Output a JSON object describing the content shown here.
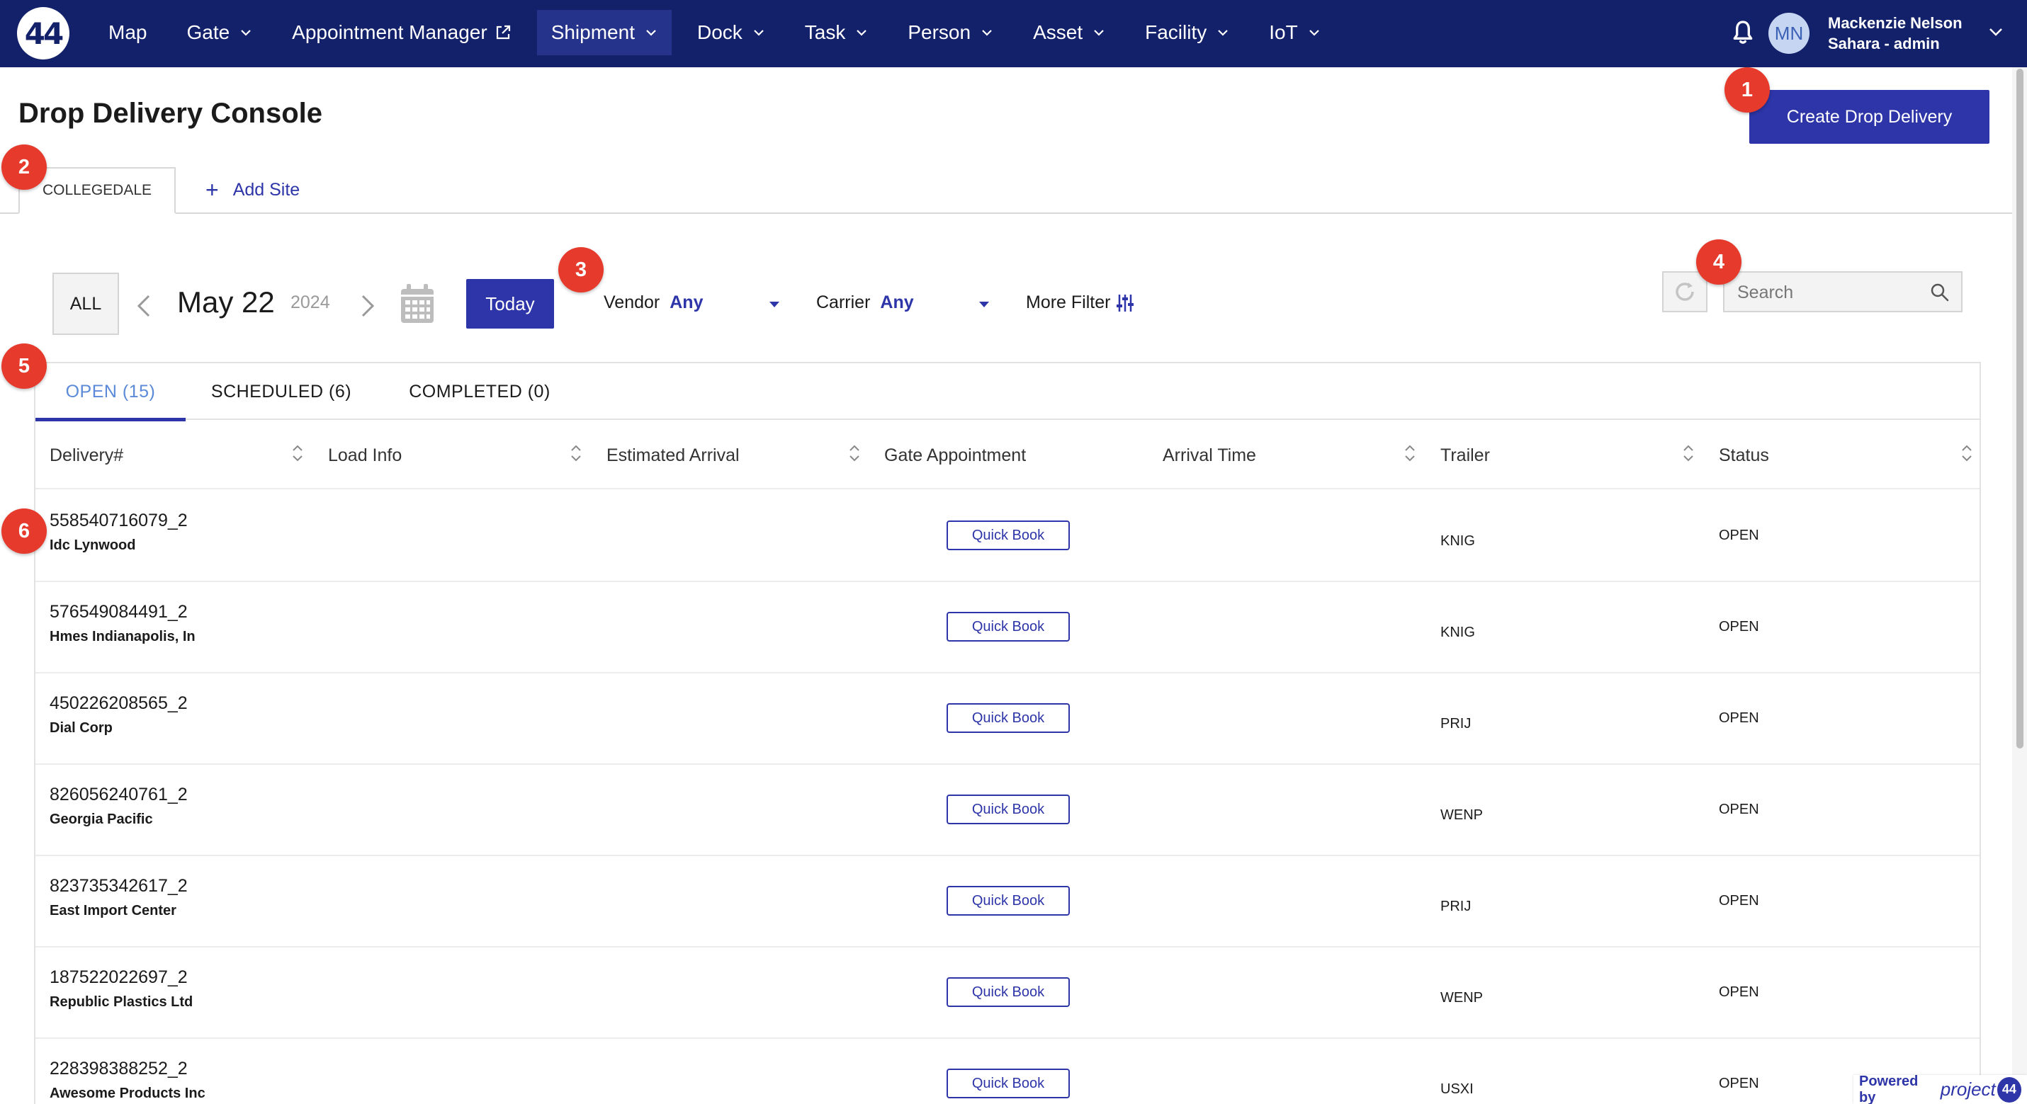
{
  "nav": {
    "logo_text": "44",
    "items": [
      {
        "label": "Map",
        "dropdown": false,
        "external": false,
        "active": false
      },
      {
        "label": "Gate",
        "dropdown": true,
        "external": false,
        "active": false
      },
      {
        "label": "Appointment Manager",
        "dropdown": false,
        "external": true,
        "active": false
      },
      {
        "label": "Shipment",
        "dropdown": true,
        "external": false,
        "active": true
      },
      {
        "label": "Dock",
        "dropdown": true,
        "external": false,
        "active": false
      },
      {
        "label": "Task",
        "dropdown": true,
        "external": false,
        "active": false
      },
      {
        "label": "Person",
        "dropdown": true,
        "external": false,
        "active": false
      },
      {
        "label": "Asset",
        "dropdown": true,
        "external": false,
        "active": false
      },
      {
        "label": "Facility",
        "dropdown": true,
        "external": false,
        "active": false
      },
      {
        "label": "IoT",
        "dropdown": true,
        "external": false,
        "active": false
      }
    ],
    "user": {
      "initials": "MN",
      "name": "Mackenzie Nelson",
      "org": "Sahara - admin"
    }
  },
  "page": {
    "title": "Drop Delivery Console",
    "create_label": "Create Drop Delivery"
  },
  "sites": {
    "active": "COLLEGEDALE",
    "add_label": "Add Site"
  },
  "filters": {
    "all_label": "ALL",
    "date": "May 22",
    "year": "2024",
    "today_label": "Today",
    "vendor_label": "Vendor",
    "vendor_value": "Any",
    "carrier_label": "Carrier",
    "carrier_value": "Any",
    "more_label": "More Filter",
    "search_placeholder": "Search"
  },
  "status_tabs": [
    {
      "label": "OPEN (15)",
      "active": true
    },
    {
      "label": "SCHEDULED (6)",
      "active": false
    },
    {
      "label": "COMPLETED (0)",
      "active": false
    }
  ],
  "table": {
    "columns": [
      "Delivery#",
      "Load Info",
      "Estimated Arrival",
      "Gate Appointment",
      "Arrival Time",
      "Trailer",
      "Status"
    ],
    "quick_book_label": "Quick Book",
    "rows": [
      {
        "id": "558540716079_2",
        "vendor": "Idc Lynwood",
        "trailer": "KNIG",
        "status": "OPEN"
      },
      {
        "id": "576549084491_2",
        "vendor": "Hmes Indianapolis, In",
        "trailer": "KNIG",
        "status": "OPEN"
      },
      {
        "id": "450226208565_2",
        "vendor": "Dial Corp",
        "trailer": "PRIJ",
        "status": "OPEN"
      },
      {
        "id": "826056240761_2",
        "vendor": "Georgia Pacific",
        "trailer": "WENP",
        "status": "OPEN"
      },
      {
        "id": "823735342617_2",
        "vendor": "East Import Center",
        "trailer": "PRIJ",
        "status": "OPEN"
      },
      {
        "id": "187522022697_2",
        "vendor": "Republic Plastics Ltd",
        "trailer": "WENP",
        "status": "OPEN"
      },
      {
        "id": "228398388252_2",
        "vendor": "Awesome Products Inc",
        "trailer": "USXI",
        "status": "OPEN"
      }
    ]
  },
  "badges": [
    "1",
    "2",
    "3",
    "4",
    "5",
    "6"
  ],
  "powered": {
    "prefix": "Powered by",
    "brand": "project",
    "brand_mark": "44"
  },
  "colors": {
    "nav_bg": "#13216a",
    "nav_active": "#26338b",
    "primary": "#2d35a8",
    "badge": "#e53a2c",
    "active_tab_text": "#5b8ad8"
  }
}
